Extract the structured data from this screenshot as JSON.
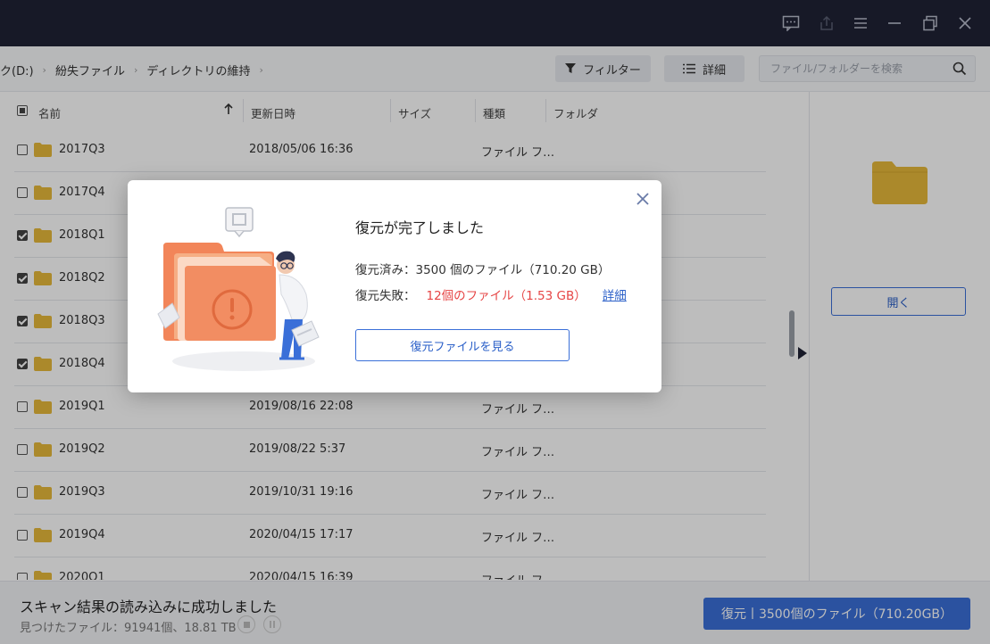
{
  "toolbar": {
    "breadcrumbs": [
      "ク(D:)",
      "紛失ファイル",
      "ディレクトリの維持"
    ],
    "filter_label": "フィルター",
    "detail_label": "詳細",
    "search_placeholder": "ファイル/フォルダーを検索"
  },
  "columns": {
    "name": "名前",
    "modified": "更新日時",
    "size": "サイズ",
    "type": "種類",
    "folder": "フォルダ"
  },
  "rows": [
    {
      "name": "2017Q3",
      "date": "2018/05/06 16:36",
      "type": "ファイル フ…",
      "checked": false
    },
    {
      "name": "2017Q4",
      "date": "",
      "type": "",
      "checked": false
    },
    {
      "name": "2018Q1",
      "date": "",
      "type": "",
      "checked": true
    },
    {
      "name": "2018Q2",
      "date": "",
      "type": "",
      "checked": true
    },
    {
      "name": "2018Q3",
      "date": "",
      "type": "",
      "checked": true
    },
    {
      "name": "2018Q4",
      "date": "",
      "type": "",
      "checked": true
    },
    {
      "name": "2019Q1",
      "date": "2019/08/16 22:08",
      "type": "ファイル フ…",
      "checked": false
    },
    {
      "name": "2019Q2",
      "date": "2019/08/22 5:37",
      "type": "ファイル フ…",
      "checked": false
    },
    {
      "name": "2019Q3",
      "date": "2019/10/31 19:16",
      "type": "ファイル フ…",
      "checked": false
    },
    {
      "name": "2019Q4",
      "date": "2020/04/15 17:17",
      "type": "ファイル フ…",
      "checked": false
    },
    {
      "name": "2020Q1",
      "date": "2020/04/15 16:39",
      "type": "ファイル フ…",
      "checked": false
    }
  ],
  "preview": {
    "open_label": "開く"
  },
  "status": {
    "main": "スキャン結果の読み込みに成功しました",
    "sub": "見つけたファイル：91941個、18.81 TB",
    "recover_label": "復元丨3500個のファイル（710.20GB）"
  },
  "modal": {
    "title": "復元が完了しました",
    "success_line": "復元済み：3500 個のファイル（710.20 GB）",
    "fail_prefix": "復元失敗：",
    "fail_value": "12個のファイル（1.53 GB）",
    "detail_link": "詳細",
    "view_button": "復元ファイルを見る"
  },
  "colors": {
    "titlebar": "#1f2235",
    "accent": "#3a6fd8",
    "error": "#e64545",
    "folder": "#e7b93a"
  }
}
